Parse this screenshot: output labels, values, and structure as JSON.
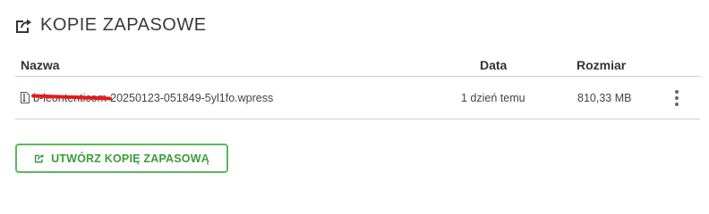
{
  "header": {
    "icon": "share-square-icon",
    "title": "KOPIE ZAPASOWE"
  },
  "table": {
    "columns": {
      "name": "Nazwa",
      "date": "Data",
      "size": "Rozmiar"
    },
    "rows": [
      {
        "icon": "file-archive-icon",
        "filename": "b-leontenticom-20250123-051849-5yl1fo.wpress",
        "date": "1 dzień temu",
        "size": "810,33 MB",
        "actions_icon": "kebab-menu-icon"
      }
    ]
  },
  "create_button": {
    "icon": "share-square-icon",
    "label": "UTWÓRZ KOPIĘ ZAPASOWĄ"
  },
  "colors": {
    "accent": "#5cb85c",
    "redaction": "#e51a1a"
  }
}
